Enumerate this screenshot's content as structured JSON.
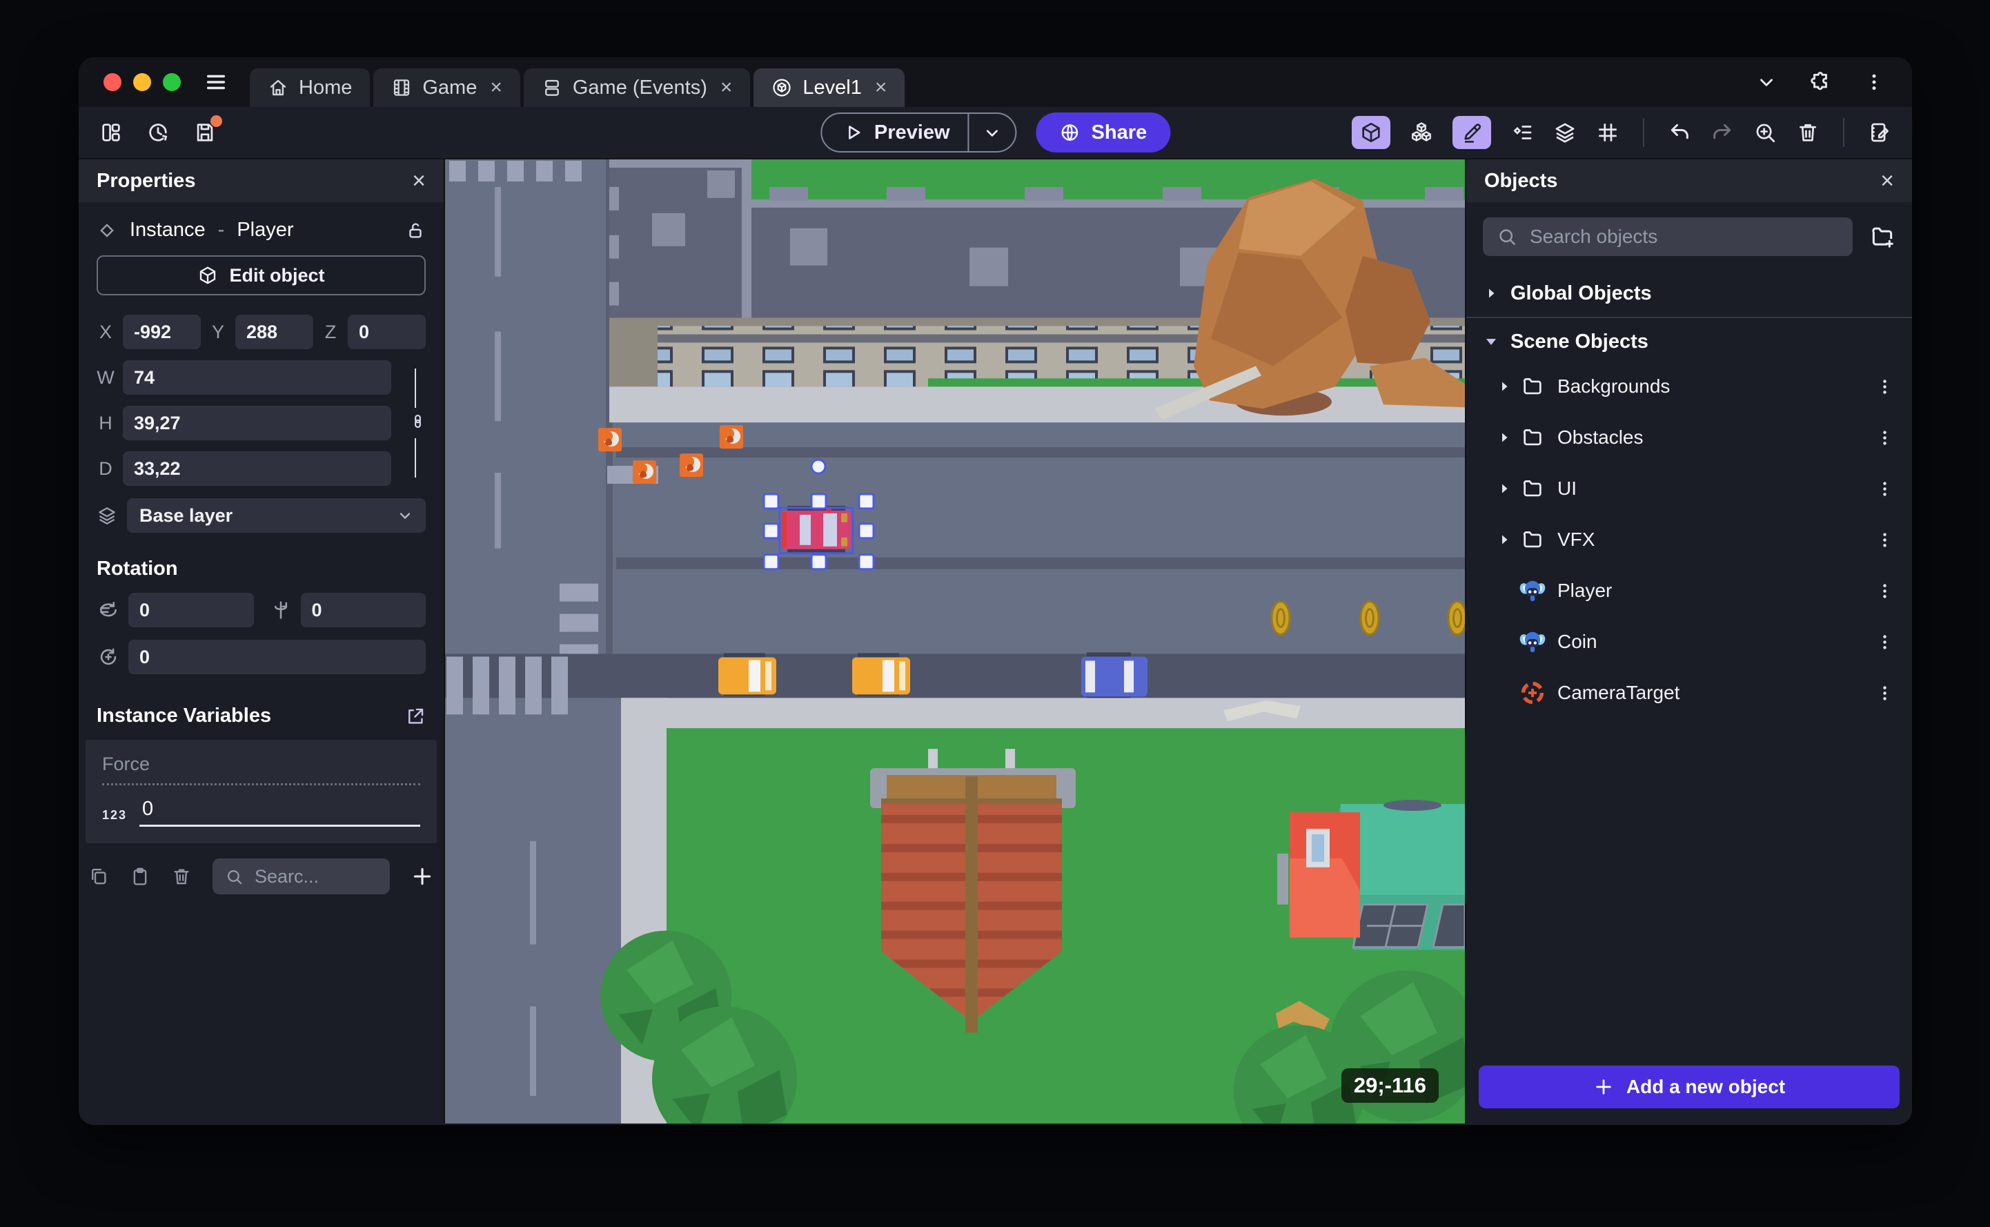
{
  "ui": {
    "close_glyph": "×"
  },
  "window": {
    "tabs": [
      {
        "label": "Home"
      },
      {
        "label": "Game"
      },
      {
        "label": "Game (Events)"
      },
      {
        "label": "Level1"
      }
    ]
  },
  "toolbar": {
    "preview_label": "Preview",
    "share_label": "Share"
  },
  "properties": {
    "title": "Properties",
    "instance_label": "Instance",
    "separator": "-",
    "object_name": "Player",
    "edit_object_label": "Edit object",
    "position": {
      "x_label": "X",
      "x": "-992",
      "y_label": "Y",
      "y": "288",
      "z_label": "Z",
      "z": "0"
    },
    "size": {
      "w_label": "W",
      "w": "74",
      "h_label": "H",
      "h": "39,27",
      "d_label": "D",
      "d": "33,22"
    },
    "layer": "Base layer",
    "rotation": {
      "title": "Rotation",
      "x": "0",
      "y": "0",
      "z": "0"
    },
    "variables": {
      "title": "Instance Variables",
      "rows": [
        {
          "name": "Force",
          "type_badge": "123",
          "value": "0"
        }
      ],
      "search_placeholder": "Searc..."
    }
  },
  "objects_panel": {
    "title": "Objects",
    "search_placeholder": "Search objects",
    "global_section": "Global Objects",
    "scene_section": "Scene Objects",
    "folders": [
      {
        "label": "Backgrounds"
      },
      {
        "label": "Obstacles"
      },
      {
        "label": "UI"
      },
      {
        "label": "VFX"
      }
    ],
    "items": [
      {
        "label": "Player",
        "icon": "monkey"
      },
      {
        "label": "Coin",
        "icon": "monkey"
      },
      {
        "label": "CameraTarget",
        "icon": "target"
      }
    ],
    "add_button": "Add a new object"
  },
  "canvas": {
    "coords_badge": "29;-116"
  },
  "colors": {
    "accent_purple": "#4b2ee0",
    "share_purple": "#5136e3",
    "active_tool": "#b7a6f6",
    "selection_blue": "#4b5ae8",
    "unsaved_dot": "#f07850",
    "traffic_lights": [
      "#ff5f57",
      "#febc2e",
      "#2ac840"
    ]
  }
}
